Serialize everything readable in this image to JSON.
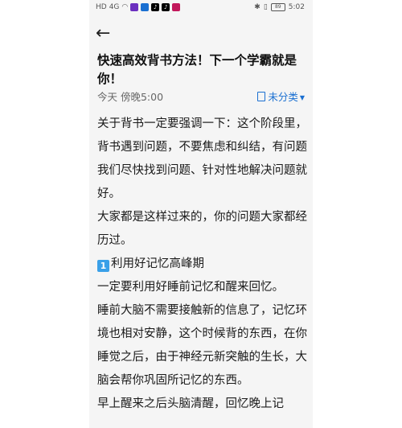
{
  "status_bar": {
    "network": "HD",
    "signal": "4G",
    "time": "5:02",
    "battery": "89"
  },
  "header": {
    "title": "快速高效背书方法！下一个学霸就是你！",
    "date": "今天 傍晚5:00",
    "category": "未分类"
  },
  "content": {
    "paragraphs": [
      "关于背书一定要强调一下：这个阶段里，背书遇到问题，不要焦虑和纠结，有问题我们尽快找到问题、针对性地解决问题就好。",
      "大家都是这样过来的，你的问题大家都经历过。",
      "利用好记忆高峰期",
      "一定要利用好睡前记忆和醒来回忆。",
      "睡前大脑不需要接触新的信息了，记忆环境也相对安静，这个时候背的东西，在你睡觉之后，由于神经元新突触的生长，大脑会帮你巩固所记忆的东西。",
      "早上醒来之后头脑清醒，回忆晚上记"
    ],
    "emoji_number": "1"
  },
  "colors": {
    "accent": "#1a6fd1",
    "background": "#f5f5f5",
    "text": "#1a1a1a"
  }
}
